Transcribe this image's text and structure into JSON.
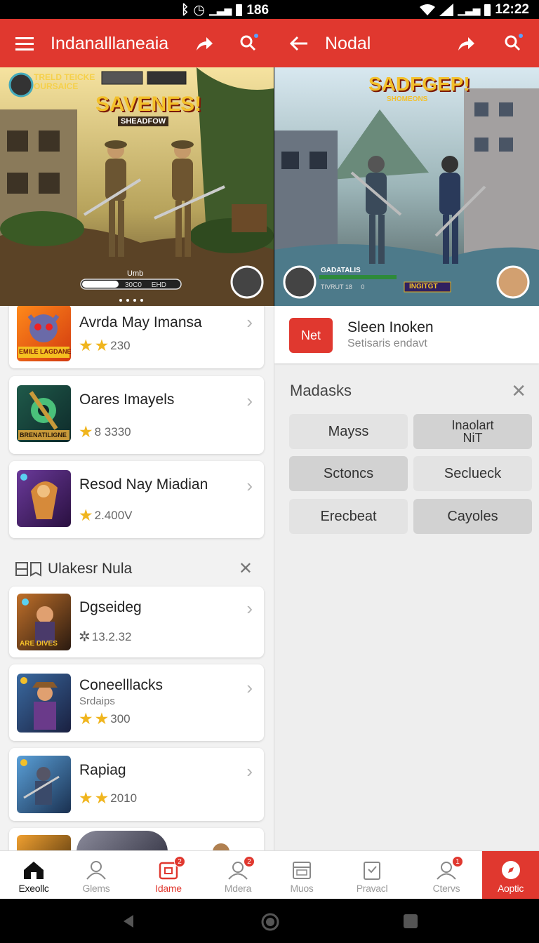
{
  "status_bar": {
    "left_text": "186",
    "time": "12:22"
  },
  "left_appbar": {
    "title": "Indanalllaneaia",
    "icons": [
      "menu-icon",
      "share-icon",
      "search-icon"
    ]
  },
  "right_appbar": {
    "title": "Nodal",
    "icons": [
      "back-arrow-icon",
      "share-icon",
      "search-icon"
    ]
  },
  "hero_left": {
    "logo_text": "SAVENES!",
    "logo_sub": "SHEADFOW",
    "badge_line1": "TRELD TEICKE",
    "badge_line2": "OURSAICE",
    "hud_label": "Umb",
    "hud_bar_text": "30C0     EHD",
    "page_dots": 4
  },
  "hero_right": {
    "logo_text": "SADFGEP!",
    "logo_sub": "SHOMEONS",
    "hud_label": "GADATALIS",
    "hud_sub": "TIVRUT 18     0",
    "hud_tag": "INGITGT"
  },
  "left_list": {
    "items": [
      {
        "title": "Avrda May Imansa",
        "rating": "230",
        "stars": 2,
        "thumb_label": "EMILE LAGDANE"
      },
      {
        "title": "Oares Imayels",
        "rating": "8 3330",
        "stars": 1,
        "thumb_label": "BRENATILIGNE"
      },
      {
        "title": "Resod Nay Miadian",
        "rating": "2.400V",
        "stars": 1,
        "thumb_label": ""
      }
    ],
    "section_title": "Ulakesr Nula",
    "section_items": [
      {
        "title": "Dgseideg",
        "subtitle": "",
        "rating": "13.2.32",
        "stars": 0,
        "thumb_label": "ARE DIVES"
      },
      {
        "title": "Coneelllacks",
        "subtitle": "Srdaips",
        "rating": "300",
        "stars": 2,
        "thumb_label": ""
      },
      {
        "title": "Rapiag",
        "subtitle": "",
        "rating": "2010",
        "stars": 2,
        "thumb_label": ""
      }
    ]
  },
  "right_panel": {
    "promo": {
      "button_label": "Net",
      "title": "Sleen Inoken",
      "subtitle": "Setisaris endavt"
    },
    "section_title": "Madasks",
    "chips": [
      "Mayss",
      "Inaolart NiT",
      "Sctoncs",
      "Secluеck",
      "Erecbeat",
      "Cayoles"
    ]
  },
  "bottom_nav": {
    "items": [
      {
        "label": "Exeollc",
        "icon": "home-icon",
        "badge": ""
      },
      {
        "label": "Glems",
        "icon": "profile-icon",
        "badge": ""
      },
      {
        "label": "Idame",
        "icon": "store-icon",
        "badge": "2"
      },
      {
        "label": "Mdera",
        "icon": "user-icon",
        "badge": "2"
      },
      {
        "label": "Muos",
        "icon": "calendar-icon",
        "badge": ""
      },
      {
        "label": "Pravacl",
        "icon": "clipboard-icon",
        "badge": ""
      },
      {
        "label": "Ctervs",
        "icon": "person-alert-icon",
        "badge": "1"
      },
      {
        "label": "Aoptic",
        "icon": "compass-icon",
        "badge": ""
      }
    ]
  },
  "colors": {
    "accent": "#e0382f",
    "star": "#f0b51e"
  }
}
